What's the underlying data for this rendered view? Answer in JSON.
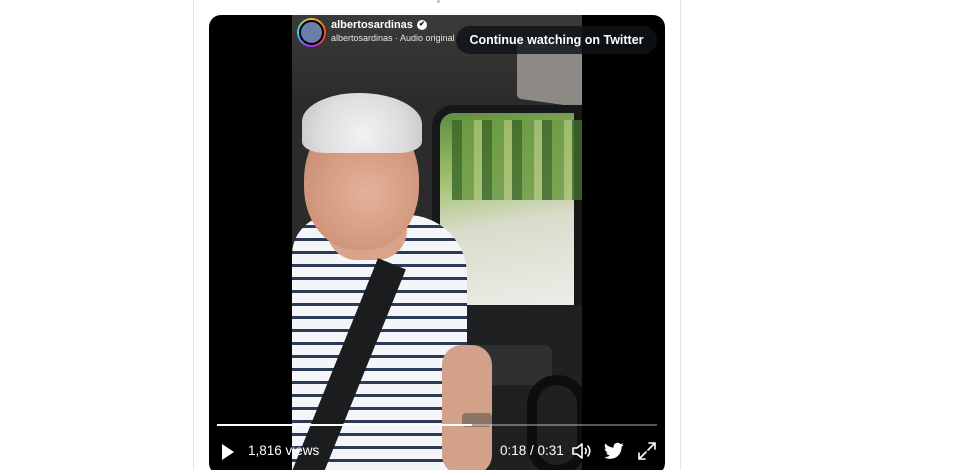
{
  "video": {
    "account_name": "albertosardinas",
    "account_subline": "albertosardinas · Audio original",
    "continue_label": "Continue watching on Twitter",
    "views": "1,816 views",
    "time_display": "0:18 / 0:31",
    "progress_fraction": 0.58
  },
  "icons": {
    "play": "play-icon",
    "volume": "volume-icon",
    "twitter": "twitter-bird-icon",
    "expand": "expand-icon",
    "verified": "verified-badge-icon"
  },
  "colors": {
    "background": "#ffffff",
    "video_bg": "#000000",
    "card_border": "#e1e8ed",
    "control_text": "#ffffff"
  }
}
